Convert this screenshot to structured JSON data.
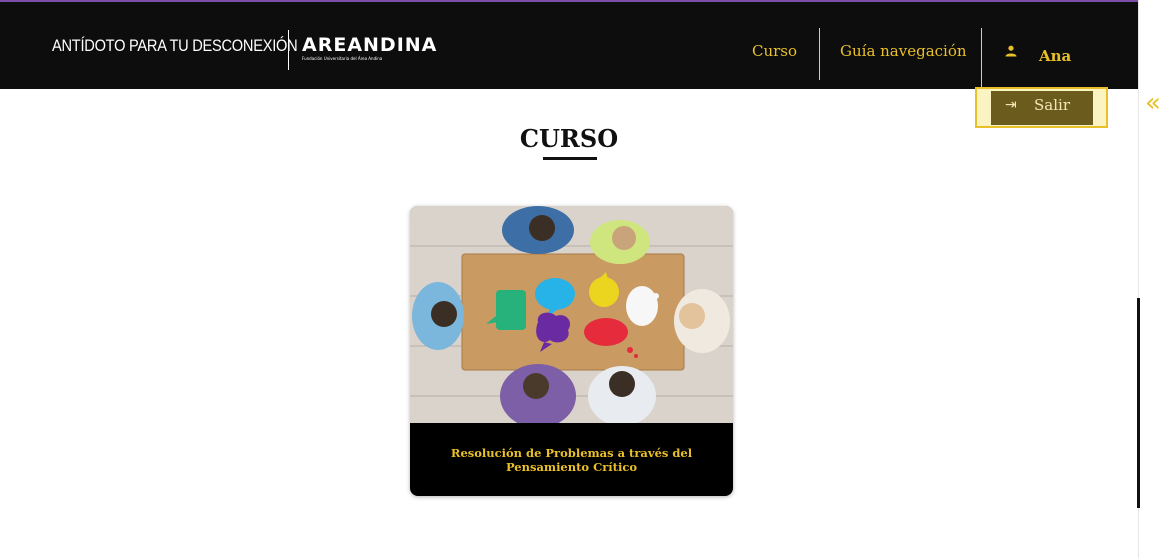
{
  "header": {
    "brand_text": "ANTÍDOTO PARA TU DESCONEXIÓN",
    "logo_text": "AREANDINA",
    "logo_subtext": "Fundación Universitaria del Área Andina",
    "nav": [
      {
        "label": "Curso"
      },
      {
        "label": "Guía navegación"
      }
    ],
    "user": {
      "name": "Ana",
      "icon": "user-icon"
    }
  },
  "dropdown": {
    "logout_label": "Salir",
    "icon": "logout-icon"
  },
  "sidebar_toggle": {
    "glyph": "«",
    "icon": "double-chevron-left-icon"
  },
  "main": {
    "title": "CURSO",
    "courses": [
      {
        "title": "Resolución de Problemas a través del Pensamiento Crítico"
      }
    ]
  },
  "colors": {
    "accent": "#e9c028",
    "topbar": "#0d0d0d",
    "top_border": "#7b4fa8"
  }
}
